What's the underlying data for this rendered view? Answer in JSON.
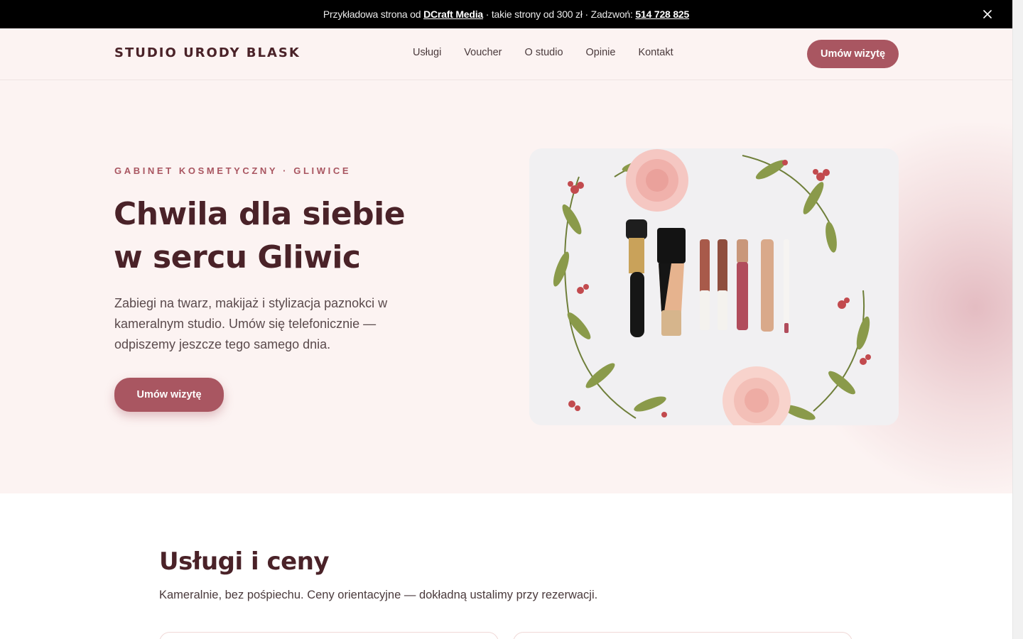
{
  "announcement": {
    "prefix": "Przykładowa strona od",
    "agency": "DCraft Media",
    "middle": "· takie strony od 300 zł · Zadzwoń:",
    "phone": "514 728 825",
    "close_icon": "close-icon"
  },
  "header": {
    "brand": "STUDIO URODY BLASK",
    "nav": [
      {
        "label": "Usługi"
      },
      {
        "label": "Voucher"
      },
      {
        "label": "O studio"
      },
      {
        "label": "Opinie"
      },
      {
        "label": "Kontakt"
      }
    ],
    "cta": "Umów wizytę"
  },
  "hero": {
    "eyebrow": "GABINET KOSMETYCZNY · GLIWICE",
    "title_line1": "Chwila dla siebie",
    "title_line2": "w sercu Gliwic",
    "lead": "Zabiegi na twarz, makijaż i stylizacja paznokci w kameralnym studio. Umów się telefonicznie — odpiszemy jeszcze tego samego dnia.",
    "cta": "Umów wizytę"
  },
  "services": {
    "title": "Usługi i ceny",
    "subtitle": "Kameralnie, bez pośpiechu. Ceny orientacyjne — dokładną ustalimy przy rezerwacji."
  },
  "colors": {
    "accent": "#a95661",
    "heading": "#4a2228",
    "hero_bg": "#fcf3f2"
  }
}
